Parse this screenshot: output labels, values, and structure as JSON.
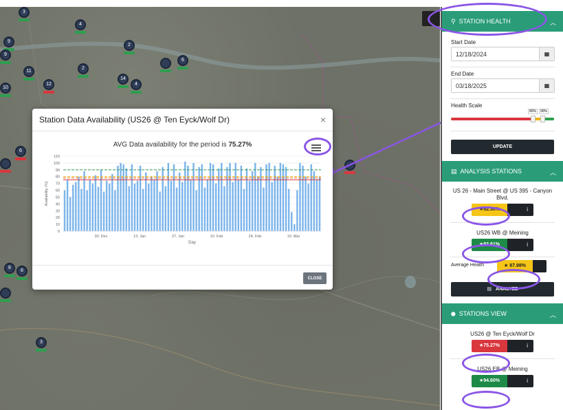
{
  "map": {
    "markers": [
      {
        "label": "3",
        "x": 27,
        "y": 0,
        "bar": "g"
      },
      {
        "label": "4",
        "x": 109,
        "y": 18,
        "bar": "g"
      },
      {
        "label": "9",
        "x": 5,
        "y": 43,
        "bar": "g"
      },
      {
        "label": "9",
        "x": 0,
        "y": 62,
        "bar": "g"
      },
      {
        "label": "2",
        "x": 180,
        "y": 48,
        "bar": "g"
      },
      {
        "label": "6",
        "x": 258,
        "y": 70,
        "bar": "g"
      },
      {
        "label": "",
        "x": 233,
        "y": 74,
        "bar": "g"
      },
      {
        "label": "11",
        "x": 34,
        "y": 86,
        "bar": "g"
      },
      {
        "label": "2",
        "x": 113,
        "y": 82,
        "bar": "g"
      },
      {
        "label": "14",
        "x": 171,
        "y": 97,
        "bar": "g"
      },
      {
        "label": "4",
        "x": 190,
        "y": 105,
        "bar": "g"
      },
      {
        "label": "10",
        "x": 0,
        "y": 110,
        "bar": "g"
      },
      {
        "label": "12",
        "x": 63,
        "y": 105,
        "bar": "r"
      },
      {
        "label": "6",
        "x": 22,
        "y": 202,
        "bar": "r"
      },
      {
        "label": "",
        "x": 0,
        "y": 220,
        "bar": "r"
      },
      {
        "label": "",
        "x": 501,
        "y": 222,
        "bar": "r"
      },
      {
        "label": "8",
        "x": 6,
        "y": 372,
        "bar": "g"
      },
      {
        "label": "8",
        "x": 24,
        "y": 376,
        "bar": "g"
      },
      {
        "label": "",
        "x": 0,
        "y": 408,
        "bar": "g"
      },
      {
        "label": "3",
        "x": 52,
        "y": 480,
        "bar": "g"
      }
    ]
  },
  "modal": {
    "title": "Station Data Availability (US26 @ Ten Eyck/Wolf Dr)",
    "close_x": "×",
    "close_label": "CLOSE",
    "avg_prefix": "AVG Data availability for the period is ",
    "avg_value": "75.27%"
  },
  "chart_data": {
    "type": "bar",
    "title": "AVG Data availability for the period is 75.27%",
    "xlabel": "Day",
    "ylabel": "Availability (%)",
    "ylim": [
      0,
      110
    ],
    "yticks": [
      0,
      10,
      20,
      30,
      40,
      50,
      60,
      70,
      80,
      90,
      100,
      110
    ],
    "xticks": [
      "30. Dec",
      "13. Jan",
      "27. Jan",
      "10. Feb",
      "24. Feb",
      "10. Mar"
    ],
    "reference_lines": [
      {
        "value": 90,
        "color": "#2e9e4f",
        "style": "dashed"
      },
      {
        "value": 80,
        "color": "#f0b400",
        "style": "dashed"
      },
      {
        "value": 78,
        "color": "#e8742c",
        "style": "dashed"
      },
      {
        "value": 75.27,
        "color": "#d9363e",
        "style": "solid"
      }
    ],
    "values": [
      60,
      75,
      50,
      68,
      72,
      80,
      62,
      88,
      60,
      76,
      70,
      82,
      65,
      90,
      58,
      74,
      70,
      84,
      60,
      96,
      100,
      98,
      92,
      66,
      98,
      70,
      74,
      96,
      62,
      86,
      70,
      80,
      76,
      88,
      58,
      94,
      66,
      100,
      74,
      98,
      64,
      86,
      72,
      102,
      96,
      76,
      100,
      60,
      94,
      98,
      64,
      76,
      100,
      98,
      70,
      92,
      100,
      66,
      94,
      100,
      72,
      100,
      76,
      96,
      62,
      92,
      74,
      88,
      100,
      80,
      94,
      64,
      98,
      100,
      72,
      96,
      80,
      100,
      98,
      94,
      62,
      28,
      10,
      60,
      100,
      96,
      80,
      70,
      98,
      88,
      76,
      80
    ],
    "bar_color": "#7cb5ec"
  },
  "panel": {
    "health": {
      "title": "STATION HEALTH",
      "start_label": "Start Date",
      "start_value": "12/18/2024",
      "end_label": "End Date",
      "end_value": "03/18/2025",
      "scale_label": "Health Scale",
      "scale_low": "80%",
      "scale_high": "90%",
      "update_label": "UPDATE"
    },
    "analysis": {
      "title": "ANALYSIS STATIONS",
      "stations": [
        {
          "name": "US 26 - Main Street @ US 395 - Canyon Blvd.",
          "value": "82.36%",
          "color": "#f5c518",
          "text_color": "#222"
        },
        {
          "name": "US26 WB @ Meining",
          "value": "93.61%",
          "color": "#1e8a47",
          "text_color": "#fff"
        }
      ],
      "avg_label": "Average Health",
      "avg_value": "87.98%",
      "analyze_label": "ANALYZE"
    },
    "view": {
      "title": "STATIONS VIEW",
      "stations": [
        {
          "name": "US26 @ Ten Eyck/Wolf Dr",
          "value": "75.27%",
          "color": "#d9363e",
          "text_color": "#fff"
        },
        {
          "name": "US26 EB @ Meining",
          "value": "94.60%",
          "color": "#1e8a47",
          "text_color": "#fff"
        }
      ]
    },
    "icons": {
      "star": "★",
      "info": "i",
      "chevron": "︿",
      "calendar": "▦",
      "search": "⚲",
      "pin": "⬤",
      "chart": "▤"
    }
  }
}
